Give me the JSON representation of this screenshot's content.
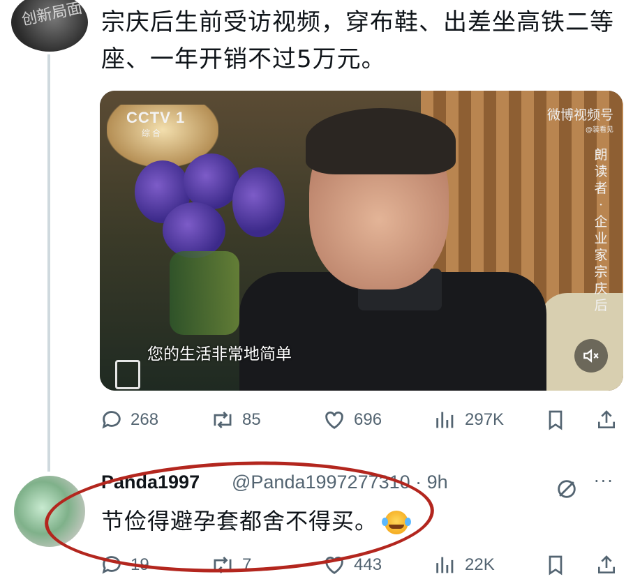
{
  "post": {
    "text_line1": "宗庆后生前受访视频，穿布鞋、出差坐高铁二等",
    "text_line2": "座、一年开销不过5万元。",
    "media": {
      "channel_logo": "CCTV 1",
      "channel_sub": "综合",
      "watermark": "微博视频号",
      "watermark_sub": "@装看见",
      "vertical_caption": "朗读者·企业家宗庆后",
      "subtitle": "您的生活非常地简单"
    },
    "stats": {
      "replies": "268",
      "reposts": "85",
      "likes": "696",
      "views": "297K"
    }
  },
  "reply": {
    "name": "Panda1997",
    "handle_time": "@Panda1997277310 · 9h",
    "text": "节俭得避孕套都舍不得买。",
    "stats": {
      "replies": "19",
      "reposts": "7",
      "likes": "443",
      "views": "22K"
    }
  },
  "colors": {
    "icon_gray": "#536471",
    "annotation_red": "#b3261e",
    "thread_line": "#cfd9de"
  },
  "icons": [
    "reply-icon",
    "repost-icon",
    "like-icon",
    "views-icon",
    "bookmark-icon",
    "share-icon",
    "mute-icon",
    "grok-icon",
    "more-icon"
  ]
}
